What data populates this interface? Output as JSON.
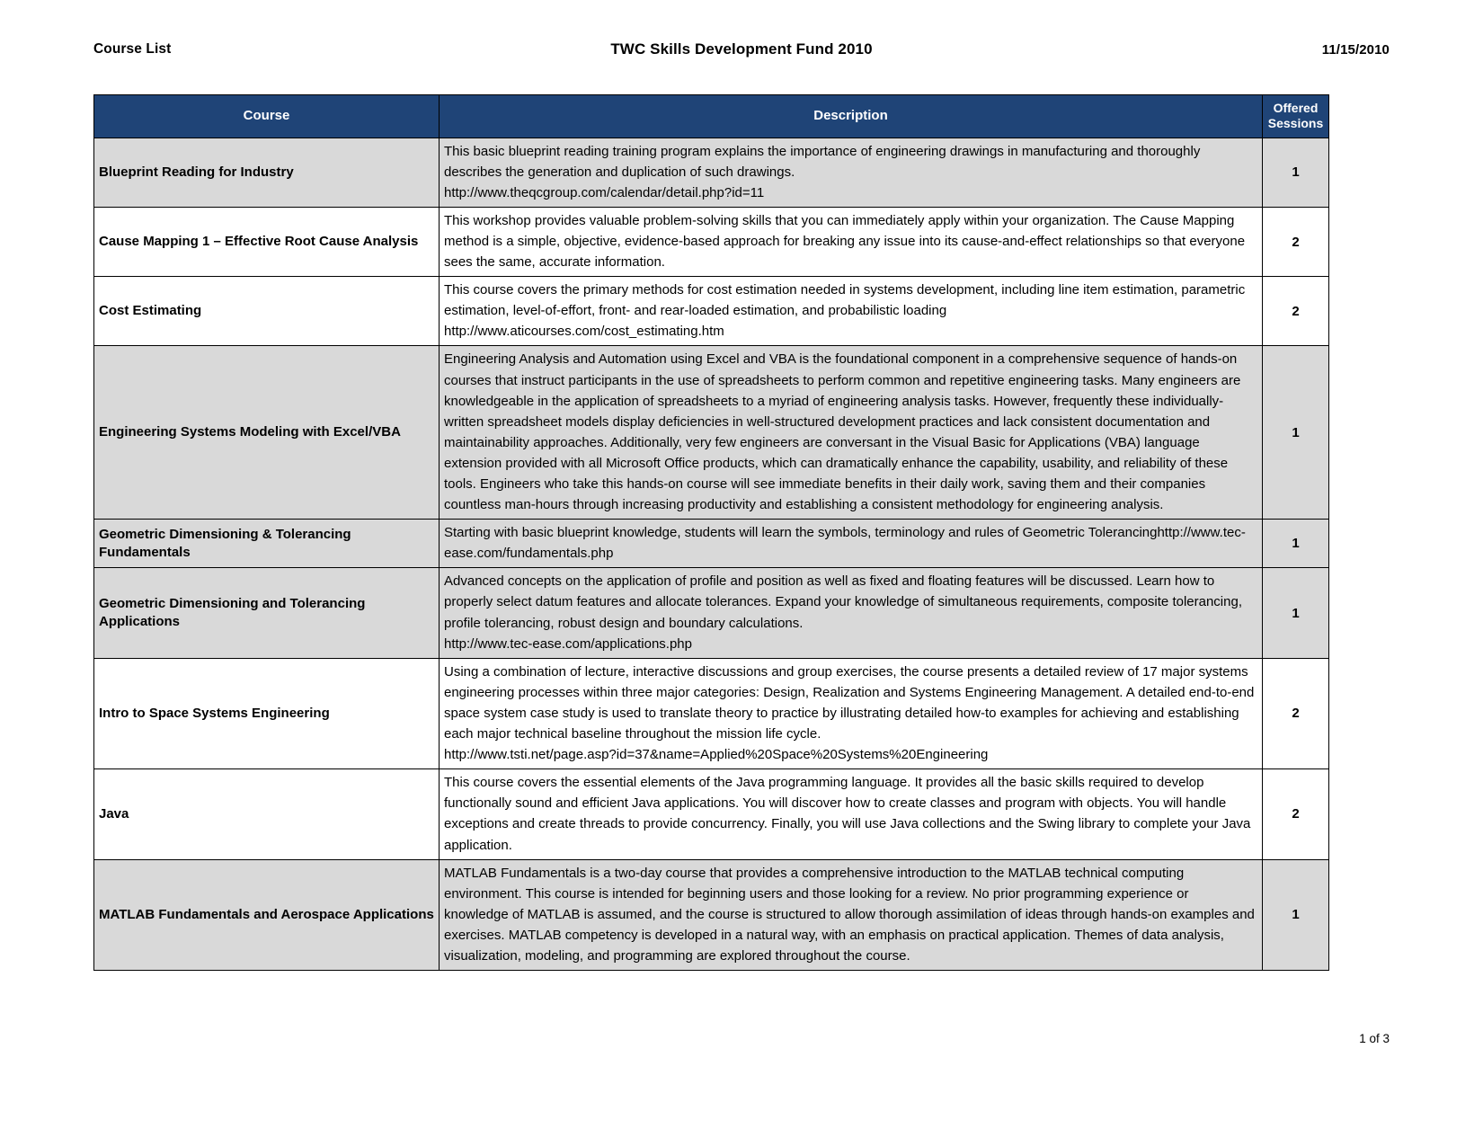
{
  "header": {
    "left_label": "Course List",
    "title": "TWC Skills Development Fund 2010",
    "date": "11/15/2010"
  },
  "table": {
    "columns": {
      "course": "Course",
      "description": "Description",
      "sessions_line1": "Offered",
      "sessions_line2": "Sessions"
    },
    "rows": [
      {
        "course": "Blueprint Reading for Industry",
        "description": "This basic blueprint reading training program explains the importance of engineering drawings in manufacturing and thoroughly describes the generation and duplication of such drawings.",
        "description_url": "http://www.theqcgroup.com/calendar/detail.php?id=11",
        "sessions": "1",
        "shaded": true
      },
      {
        "course": "Cause Mapping 1 – Effective Root Cause Analysis",
        "description": "This workshop provides valuable problem-solving skills that you can immediately apply within your organization. The Cause Mapping method is a simple, objective, evidence-based approach for breaking any issue into its cause-and-effect relationships so that everyone sees the same, accurate information.",
        "description_url": "",
        "sessions": "2",
        "shaded": false
      },
      {
        "course": "Cost Estimating",
        "description": "This course covers the primary methods for cost estimation needed in systems development, including line item estimation, parametric estimation, level-of-effort, front- and rear-loaded estimation, and probabilistic loading",
        "description_url": "http://www.aticourses.com/cost_estimating.htm",
        "sessions": "2",
        "shaded": false
      },
      {
        "course": "Engineering Systems Modeling with Excel/VBA",
        "description": "Engineering Analysis and Automation using Excel and VBA is the foundational component in a comprehensive sequence of hands-on courses that instruct participants in the use of spreadsheets to perform common and repetitive engineering tasks. Many engineers are knowledgeable in the application of spreadsheets to a myriad of engineering analysis tasks. However, frequently these individually-written spreadsheet models display deficiencies in well-structured development practices and lack consistent documentation and maintainability approaches. Additionally, very few engineers are conversant in the Visual Basic for Applications (VBA) language extension provided with all Microsoft Office products, which can dramatically enhance the capability, usability, and reliability of these tools. Engineers who take this hands-on course will see immediate benefits in their daily work, saving them and their companies countless man-hours through increasing productivity and establishing a consistent methodology for engineering analysis.",
        "description_url": "",
        "sessions": "1",
        "shaded": true
      },
      {
        "course": "Geometric Dimensioning & Tolerancing Fundamentals",
        "description": "Starting with basic blueprint knowledge, students will learn the symbols, terminology and rules of Geometric Tolerancinghttp://www.tec-ease.com/fundamentals.php",
        "description_url": "",
        "sessions": "1",
        "shaded": true
      },
      {
        "course": "Geometric Dimensioning and Tolerancing Applications",
        "description": "Advanced concepts on the application of profile and position as well as fixed and floating features will be discussed. Learn how to properly select datum features and allocate tolerances. Expand your knowledge of simultaneous requirements, composite tolerancing, profile tolerancing, robust design and boundary calculations.",
        "description_url": "http://www.tec-ease.com/applications.php",
        "sessions": "1",
        "shaded": true
      },
      {
        "course": "Intro to Space Systems Engineering",
        "description": "Using a combination of lecture, interactive discussions and group exercises, the course presents a detailed review of 17 major systems engineering processes within three major categories: Design, Realization and Systems Engineering Management.  A detailed end-to-end space system case study is used to translate theory to practice by illustrating detailed how-to examples for achieving and establishing each major technical baseline throughout the mission life cycle.",
        "description_url": "http://www.tsti.net/page.asp?id=37&name=Applied%20Space%20Systems%20Engineering",
        "sessions": "2",
        "shaded": false
      },
      {
        "course": "Java",
        "description": "This course covers the essential elements of the Java programming language. It provides all the basic skills required to develop functionally sound and efficient Java applications.  You will discover how to create classes and program with objects. You will handle exceptions and create threads to provide concurrency. Finally, you will use Java collections and the Swing library to complete your Java application.",
        "description_url": "",
        "sessions": "2",
        "shaded": false
      },
      {
        "course": "MATLAB Fundamentals and Aerospace Applications",
        "description": "MATLAB Fundamentals is a two-day course that provides a comprehensive introduction to the MATLAB technical computing environment. This course is intended for beginning users and those looking for a review. No prior programming experience or knowledge of MATLAB is assumed, and the course is structured to allow thorough assimilation of ideas through hands-on examples and exercises. MATLAB competency is developed in a natural way, with an emphasis on practical application. Themes of data analysis, visualization, modeling, and programming are explored throughout the course.",
        "description_url": "",
        "sessions": "1",
        "shaded": true
      }
    ]
  },
  "footer": {
    "page_label": "1 of 3"
  },
  "colors": {
    "header_fill": "#1f4477",
    "shaded_row": "#d9d9d9",
    "border": "#000000"
  }
}
